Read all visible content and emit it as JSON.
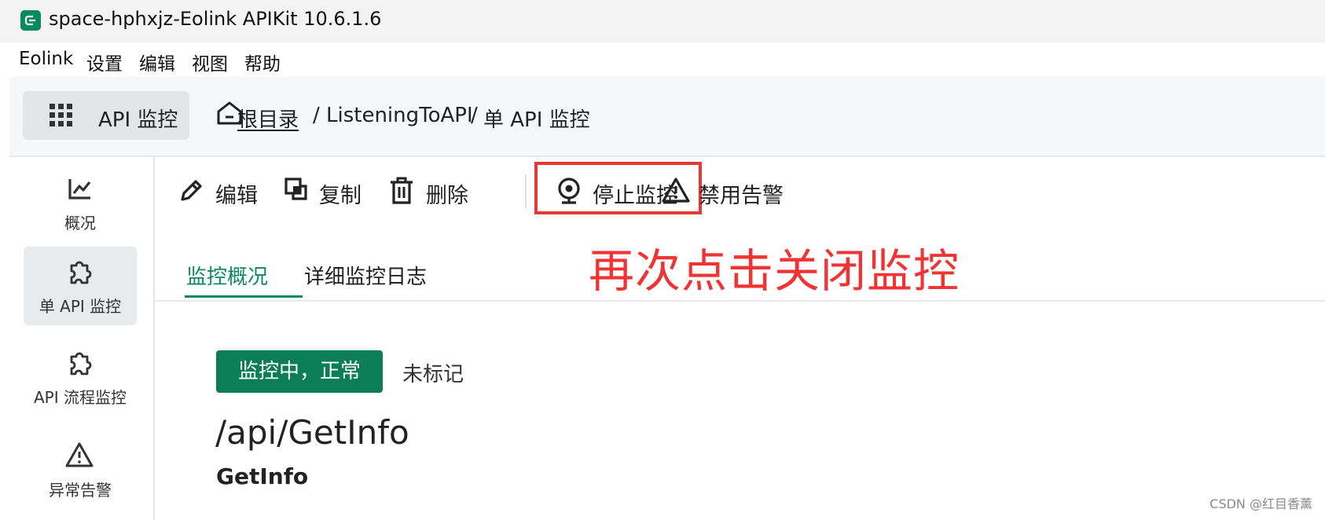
{
  "window": {
    "title": "space-hphxjz-Eolink APIKit 10.6.1.6"
  },
  "menubar": {
    "items": [
      "Eolink",
      "设置",
      "编辑",
      "视图",
      "帮助"
    ]
  },
  "header": {
    "module_label": "API 监控",
    "breadcrumb": {
      "root": "根目录",
      "sep1": "/",
      "folder": "ListeningToAPI",
      "sep2": "/",
      "current": "单 API 监控"
    }
  },
  "sidebar": {
    "items": [
      {
        "label": "概况",
        "icon": "chart-line-icon"
      },
      {
        "label": "单 API 监控",
        "icon": "puzzle-icon",
        "active": true
      },
      {
        "label": "API 流程监控",
        "icon": "puzzle-icon"
      },
      {
        "label": "异常告警",
        "icon": "warning-icon"
      }
    ]
  },
  "toolbar": {
    "edit": "编辑",
    "copy": "复制",
    "delete": "删除",
    "stop_monitor": "停止监控",
    "disable_alert": "禁用告警"
  },
  "annotation": {
    "text": "再次点击关闭监控",
    "color": "#f03333"
  },
  "tabs": [
    {
      "label": "监控概况",
      "active": true
    },
    {
      "label": "详细监控日志",
      "active": false
    }
  ],
  "detail": {
    "status": "监控中，正常",
    "tag": "未标记",
    "path": "/api/GetInfo",
    "name": "GetInfo"
  },
  "watermark": "CSDN @红目香薰",
  "colors": {
    "brand": "#0b8a5d",
    "status_bg": "#0b7d57",
    "highlight": "#e53935"
  }
}
